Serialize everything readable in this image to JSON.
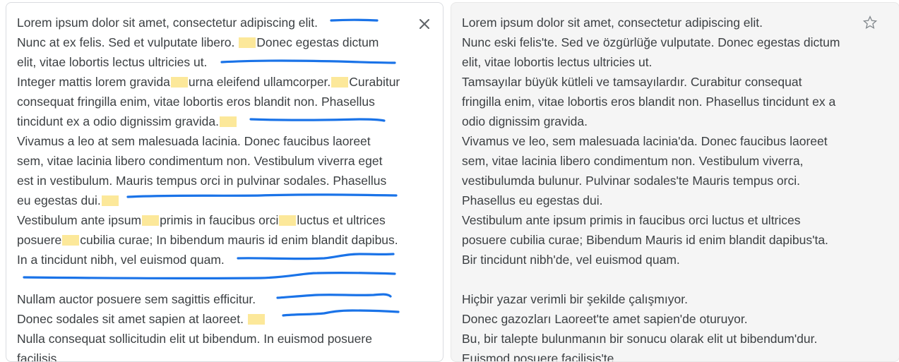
{
  "colors": {
    "accent": "#1a73e8",
    "highlight": "#fce89a",
    "text": "#3c4043",
    "target_background": "#f5f5f5"
  },
  "source": {
    "lines": [
      "Lorem ipsum dolor sit amet, consectetur adipiscing elit.",
      "Nunc at ex felis. Sed et vulputate libero. ",
      "Donec egestas dictum",
      "elit, vitae lobortis lectus ultricies ut.",
      "Integer mattis lorem gravida",
      "urna eleifend ullamcorper.",
      "Curabitur",
      "consequat fringilla enim, vitae lobortis eros blandit non. Phasellus",
      "tincidunt ex a odio dignissim gravida.",
      "Vivamus a leo at sem malesuada lacinia. Donec faucibus laoreet",
      "sem, vitae lacinia libero condimentum non. Vestibulum viverra eget",
      "est in vestibulum. Mauris tempus orci in pulvinar sodales. Phasellus",
      "eu egestas dui.",
      "Vestibulum ante ipsum",
      "primis in faucibus orci",
      "luctus et ultrices",
      "posuere",
      "cubilia curae; In bibendum mauris id enim blandit dapibus.",
      "In a tincidunt nibh, vel euismod quam.",
      "Nullam auctor posuere sem sagittis efficitur.",
      "Donec sodales sit amet sapien at laoreet.",
      "Nulla consequat sollicitudin elit ut bibendum. In euismod posuere",
      "facilisis."
    ],
    "clear_icon": "close-icon"
  },
  "target": {
    "lines": [
      "Lorem ipsum dolor sit amet, consectetur adipiscing elit.",
      "Nunc eski felis'te. Sed ve özgürlüğe vulputate. Donec egestas dictum",
      "elit, vitae lobortis lectus ultricies ut.",
      "Tamsayılar büyük kütleli ve tamsayılardır. Curabitur consequat",
      "fringilla enim, vitae lobortis eros blandit non. Phasellus tincidunt ex a",
      "odio dignissim gravida.",
      "Vivamus ve leo, sem malesuada lacinia'da. Donec faucibus laoreet",
      "sem, vitae lacinia libero condimentum non. Vestibulum viverra,",
      "vestibulumda bulunur. Pulvinar sodales'te Mauris tempus orci.",
      "Phasellus eu egestas dui.",
      "Vestibulum ante ipsum primis in faucibus orci luctus et ultrices",
      "posuere cubilia curae; Bibendum Mauris id enim blandit dapibus'ta.",
      "Bir tincidunt nibh'de, vel euismod quam.",
      "",
      "Hiçbir yazar verimli bir şekilde çalışmıyor.",
      "Donec gazozları Laoreet'te amet sapien'de oturuyor.",
      "Bu, bir talepte bulunmanın bir sonucu olarak elit ut bibendum'dur.",
      "Euismod posuere facilisis'te."
    ],
    "star_icon": "star-icon"
  }
}
